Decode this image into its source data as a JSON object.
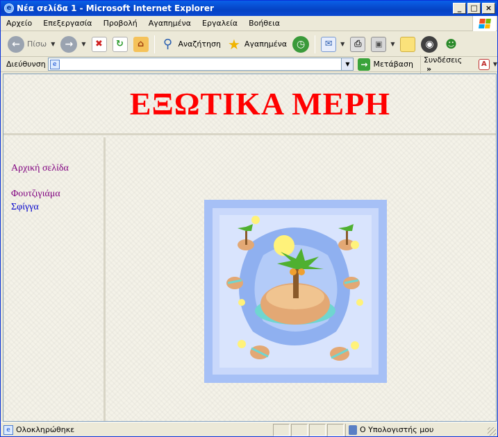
{
  "window": {
    "title": "Νέα σελίδα 1 - Microsoft Internet Explorer",
    "controls": {
      "minimize": "_",
      "maximize": "□",
      "close": "×"
    }
  },
  "menubar": {
    "items": [
      "Αρχείο",
      "Επεξεργασία",
      "Προβολή",
      "Αγαπημένα",
      "Εργαλεία",
      "Βοήθεια"
    ]
  },
  "toolbar": {
    "back_label": "Πίσω",
    "search_label": "Αναζήτηση",
    "favorites_label": "Αγαπημένα",
    "icons": [
      "back-icon",
      "forward-icon",
      "stop-icon",
      "refresh-icon",
      "home-icon",
      "search-icon",
      "favorites-icon",
      "history-icon",
      "mail-icon",
      "print-icon",
      "edit-icon",
      "discuss-icon",
      "research-icon",
      "messenger-icon"
    ]
  },
  "addressbar": {
    "label": "Διεύθυνση",
    "value": "",
    "go_label": "Μετάβαση",
    "links_label": "Συνδέσεις",
    "chevron": "»"
  },
  "page": {
    "banner_title": "ΕΞΩΤΙΚΑ ΜΕΡΗ",
    "nav_links": [
      {
        "label": "Αρχική σελίδα",
        "visited": true
      },
      {
        "label": "Φουτζιγιάμα",
        "visited": true
      },
      {
        "label": "Σφίγγα",
        "visited": false
      }
    ]
  },
  "statusbar": {
    "status_text": "Ολοκληρώθηκε",
    "zone_text": "Ο Υπολογιστής μου"
  },
  "colors": {
    "title_red": "#ff0000",
    "link_visited": "#800080",
    "link_unvisited": "#0000cc",
    "titlebar_blue": "#0a5fe8"
  }
}
